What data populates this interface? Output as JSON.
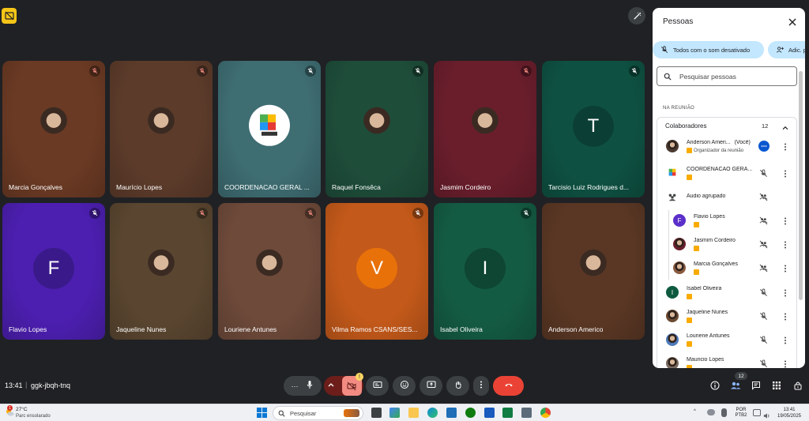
{
  "meeting": {
    "time": "13:41",
    "separator": "|",
    "code": "ggk-jbqh-tnq"
  },
  "tiles": [
    {
      "name": "Marcia Gonçalves",
      "bg": "#6b3a24",
      "type": "photo",
      "muted": true,
      "mic_color": "#f28b82"
    },
    {
      "name": "Maurício Lopes",
      "bg": "#5c3b2a",
      "type": "photo",
      "muted": true,
      "mic_color": "#f28b82"
    },
    {
      "name": "COORDENACAO GERAL ...",
      "bg": "#3e6d72",
      "type": "logo",
      "muted": true,
      "mic_color": "#ffffff"
    },
    {
      "name": "Raquel Fonsêca",
      "bg": "#1e4d3a",
      "type": "photo",
      "muted": true,
      "mic_color": "#ffffff"
    },
    {
      "name": "Jasmim Cordeiro",
      "bg": "#6a1e2c",
      "type": "photo",
      "muted": true,
      "mic_color": "#f28b82"
    },
    {
      "name": "Tarcisio Luiz Rodrigues d...",
      "bg": "#0e5142",
      "type": "letter",
      "letter": "T",
      "letter_bg": "#0b3f35",
      "muted": true,
      "mic_color": "#ffffff"
    },
    {
      "name": "Flavio Lopes",
      "bg": "#4c1fb0",
      "type": "letter",
      "letter": "F",
      "letter_bg": "#3a1a8a",
      "muted": true,
      "mic_color": "#ffffff"
    },
    {
      "name": "Jaqueline Nunes",
      "bg": "#5a4630",
      "type": "photo",
      "muted": true,
      "mic_color": "#f28b82"
    },
    {
      "name": "Louriene Antunes",
      "bg": "#6e4a3a",
      "type": "photo",
      "muted": true,
      "mic_color": "#f28b82"
    },
    {
      "name": "Vilma Ramos CSANS/SES...",
      "bg": "#c3591a",
      "type": "letter",
      "letter": "V",
      "letter_bg": "#e8710a",
      "muted": true,
      "mic_color": "#ffffff"
    },
    {
      "name": "Isabel Oliveira",
      "bg": "#145b43",
      "type": "letter",
      "letter": "I",
      "letter_bg": "#0e4533",
      "muted": true,
      "mic_color": "#ffffff"
    },
    {
      "name": "Anderson Americo",
      "bg": "#5a3724",
      "type": "photo",
      "muted": false,
      "mic_color": "#ffffff"
    }
  ],
  "controls": {
    "more_label": "···",
    "reactions_badge": "!",
    "people_count": "12"
  },
  "panel": {
    "title": "Pessoas",
    "mute_all_label": "Todos com o som desativado",
    "add_label": "Adic. p",
    "search_placeholder": "Pesquisar pessoas",
    "section_label": "NA REUNIÃO",
    "group_name": "Colaboradores",
    "group_count": "12",
    "participants": [
      {
        "name": "Anderson Ameri...",
        "suffix": "(Você)",
        "tag": "Organizador da reunião",
        "avatar": "photo",
        "avatar_bg": "#4a3a30",
        "status": "more",
        "indent": false
      },
      {
        "name": "COORDENACAO GERA...",
        "suffix": "",
        "tag": "",
        "avatar": "logo",
        "avatar_bg": "#ffffff",
        "status": "muted",
        "indent": false
      },
      {
        "name": "Audio agrupado",
        "suffix": "",
        "tag": "",
        "avatar": "group",
        "avatar_bg": "#ffffff",
        "status": "group",
        "indent": false
      },
      {
        "name": "Flavio Lopes",
        "suffix": "",
        "tag": "",
        "avatar": "letter",
        "letter": "F",
        "avatar_bg": "#5b2fc9",
        "status": "group",
        "indent": true
      },
      {
        "name": "Jasmim Cordeiro",
        "suffix": "",
        "tag": "",
        "avatar": "photo",
        "avatar_bg": "#6a1e2c",
        "status": "group",
        "indent": true
      },
      {
        "name": "Marcia Gonçalves",
        "suffix": "",
        "tag": "",
        "avatar": "photo",
        "avatar_bg": "#8a5a40",
        "status": "group",
        "indent": true
      },
      {
        "name": "Isabel Oliveira",
        "suffix": "",
        "tag": "",
        "avatar": "letter",
        "letter": "I",
        "avatar_bg": "#0e5a3f",
        "status": "muted",
        "indent": false
      },
      {
        "name": "Jaqueline Nunes",
        "suffix": "",
        "tag": "",
        "avatar": "photo",
        "avatar_bg": "#6b4a30",
        "status": "muted",
        "indent": false
      },
      {
        "name": "Louriene Antunes",
        "suffix": "",
        "tag": "",
        "avatar": "photo",
        "avatar_bg": "#4d7ab8",
        "status": "muted",
        "indent": false
      },
      {
        "name": "Mauricio Lopes",
        "suffix": "",
        "tag": "",
        "avatar": "photo",
        "avatar_bg": "#7a6a60",
        "status": "muted",
        "indent": false
      }
    ]
  },
  "taskbar": {
    "temperature": "27°C",
    "condition": "Parc ensolarado",
    "weather_badge": "1",
    "search_label": "Pesquisar",
    "lang_top": "POR",
    "lang_bottom": "PTB2",
    "clock_time": "13:41",
    "clock_date": "19/05/2025"
  },
  "colors": {
    "hangup": "#ea4335",
    "camera_off": "#f28b82",
    "accent_chip": "#c2e7ff",
    "host_badge": "#f9ab00"
  }
}
